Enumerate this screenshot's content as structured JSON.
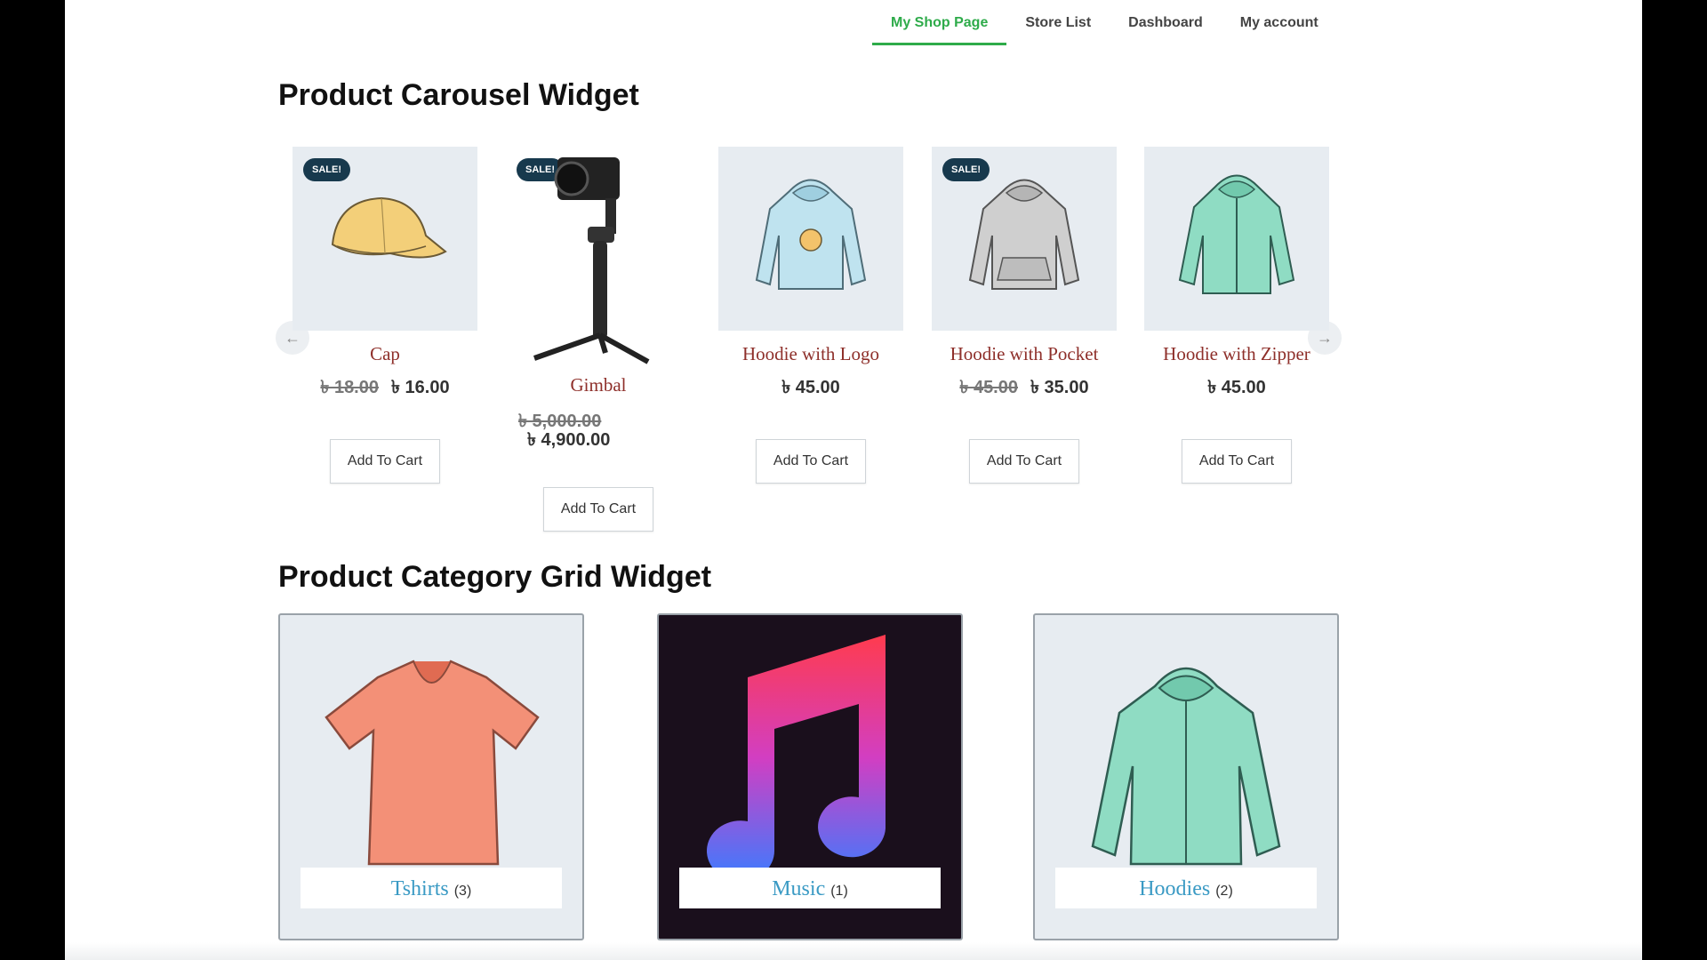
{
  "nav": {
    "items": [
      {
        "label": "My Shop Page"
      },
      {
        "label": "Store List"
      },
      {
        "label": "Dashboard"
      },
      {
        "label": "My account"
      }
    ]
  },
  "carousel": {
    "title": "Product Carousel Widget",
    "products": [
      {
        "name": "Cap",
        "old_price": "৳ 18.00",
        "price": "৳ 16.00",
        "badge": "SALE!",
        "button": "Add To Cart"
      },
      {
        "name": "Gimbal",
        "old_price": "৳ 5,000.00",
        "price": "৳ 4,900.00",
        "badge": "SALE!",
        "button": "Add To Cart"
      },
      {
        "name": "Hoodie with Logo",
        "price": "৳ 45.00",
        "button": "Add To Cart"
      },
      {
        "name": "Hoodie with Pocket",
        "old_price": "৳ 45.00",
        "price": "৳ 35.00",
        "badge": "SALE!",
        "button": "Add To Cart"
      },
      {
        "name": "Hoodie with Zipper",
        "price": "৳ 45.00",
        "button": "Add To Cart"
      }
    ],
    "prev_arrow": "←",
    "next_arrow": "→"
  },
  "categories": {
    "title": "Product Category Grid Widget",
    "items": [
      {
        "name": "Tshirts",
        "count": "(3)"
      },
      {
        "name": "Music",
        "count": "(1)"
      },
      {
        "name": "Hoodies",
        "count": "(2)"
      }
    ]
  },
  "colors": {
    "accent": "#2eab4a",
    "product_name": "#8e2f2a",
    "category_name": "#3a9ac4",
    "badge": "#17394d"
  }
}
